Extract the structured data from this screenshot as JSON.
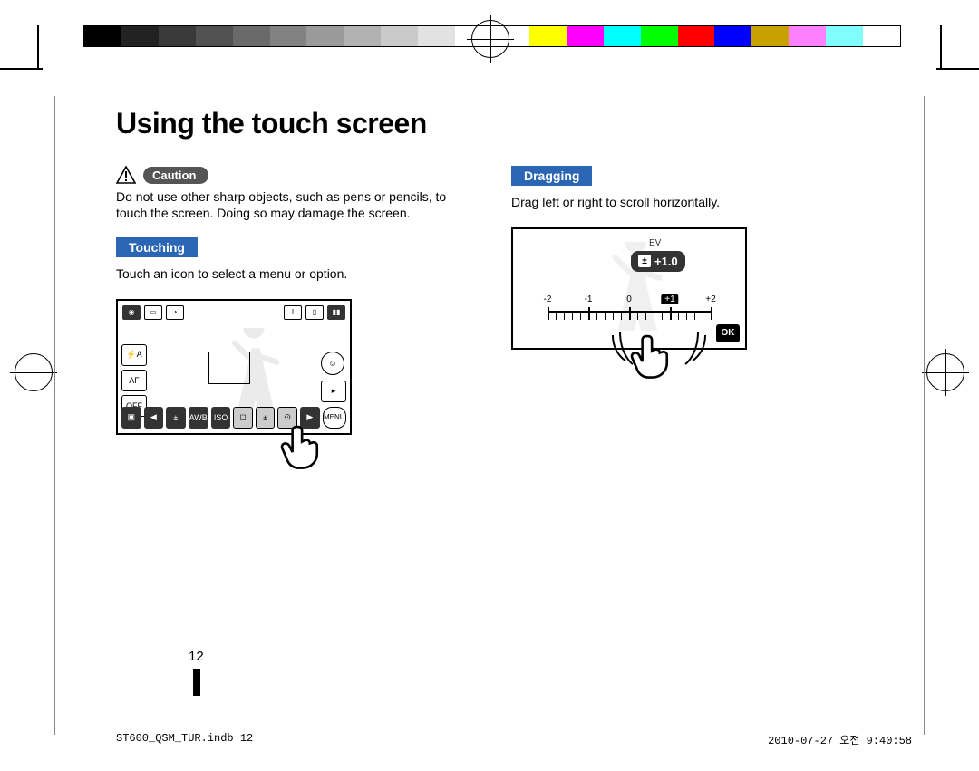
{
  "page": {
    "title": "Using the touch screen",
    "caution_label": "Caution",
    "caution_text": "Do not use other sharp objects, such as pens or pencils, to touch the screen. Doing so may damage the screen.",
    "touching_label": "Touching",
    "touching_text": "Touch an icon to select a menu or option.",
    "dragging_label": "Dragging",
    "dragging_text": "Drag left or right to scroll horizontally.",
    "page_number": "12"
  },
  "fig1": {
    "left_buttons": [
      "⚡A",
      "AF",
      "OFF"
    ],
    "bottom_buttons": [
      "◀",
      "±",
      "AWB",
      "ISO",
      "◻",
      "±",
      "⊙",
      "▶"
    ],
    "menu_label": "MENU"
  },
  "fig2": {
    "ev_caption": "EV",
    "ev_value": "+1.0",
    "scale_labels": [
      "-2",
      "-1",
      "0",
      "+1",
      "+2"
    ],
    "selected_index": 3,
    "ok_label": "OK"
  },
  "footer": {
    "left": "ST600_QSM_TUR.indb   12",
    "right": "2010-07-27   오전 9:40:58"
  },
  "colorbar": [
    "#000000",
    "#222222",
    "#3a3a3a",
    "#525252",
    "#6a6a6a",
    "#828282",
    "#9a9a9a",
    "#b2b2b2",
    "#cacaca",
    "#e2e2e2",
    "#ffffff",
    "#ffffff",
    "#ffff00",
    "#ff00ff",
    "#00ffff",
    "#00ff00",
    "#ff0000",
    "#0000ff",
    "#c8a000",
    "#ff80ff",
    "#80ffff",
    "#ffffff"
  ]
}
